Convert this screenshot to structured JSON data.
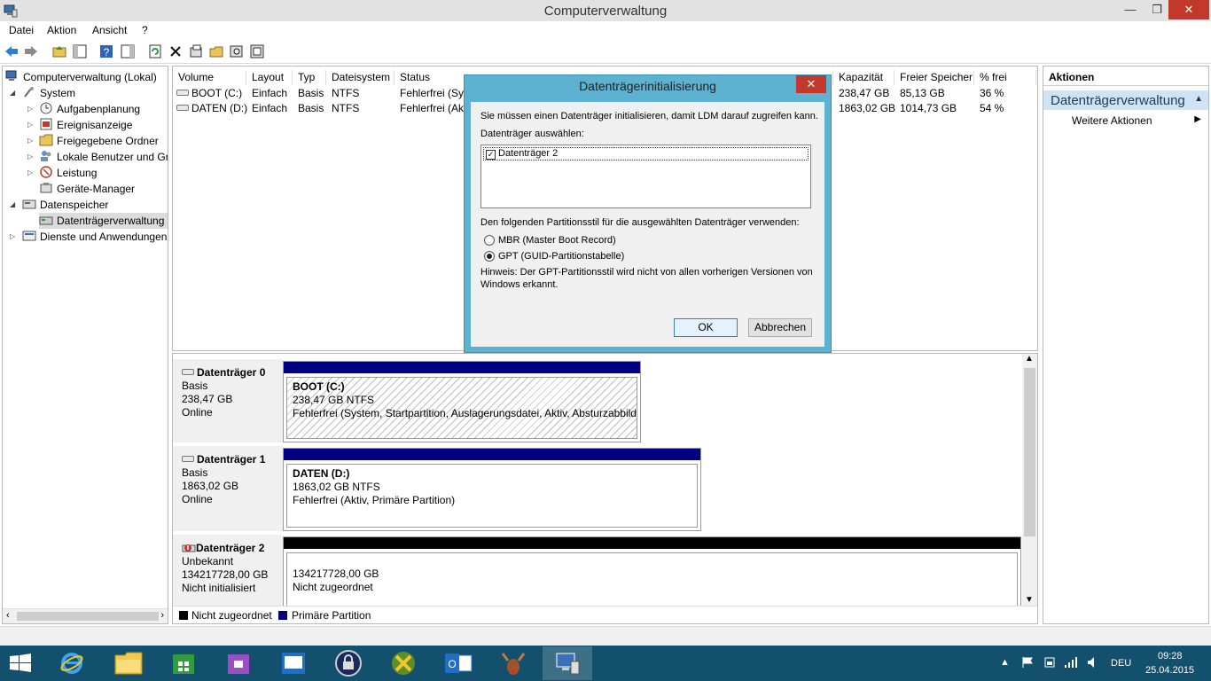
{
  "window": {
    "title": "Computerverwaltung",
    "minimize": "—",
    "maximize": "❐",
    "close": "✕"
  },
  "menu": {
    "items": [
      "Datei",
      "Aktion",
      "Ansicht",
      "?"
    ]
  },
  "tree": {
    "items": [
      {
        "label": "Computerverwaltung (Lokal)"
      },
      {
        "label": "System"
      },
      {
        "label": "Aufgabenplanung"
      },
      {
        "label": "Ereignisanzeige"
      },
      {
        "label": "Freigegebene Ordner"
      },
      {
        "label": "Lokale Benutzer und Gruppen"
      },
      {
        "label": "Leistung"
      },
      {
        "label": "Geräte-Manager"
      },
      {
        "label": "Datenspeicher"
      },
      {
        "label": "Datenträgerverwaltung"
      },
      {
        "label": "Dienste und Anwendungen"
      }
    ]
  },
  "volumes": {
    "columns": [
      "Volume",
      "Layout",
      "Typ",
      "Dateisystem",
      "Status",
      "Kapazität",
      "Freier Speicher",
      "% frei"
    ],
    "rows": [
      {
        "volume": "BOOT (C:)",
        "layout": "Einfach",
        "typ": "Basis",
        "fs": "NTFS",
        "status": "Fehlerfrei (Sys",
        "capacity": "238,47 GB",
        "free": "85,13 GB",
        "pct": "36 %"
      },
      {
        "volume": "DATEN (D:)",
        "layout": "Einfach",
        "typ": "Basis",
        "fs": "NTFS",
        "status": "Fehlerfrei (Akt",
        "capacity": "1863,02 GB",
        "free": "1014,73 GB",
        "pct": "54 %"
      }
    ]
  },
  "disks": [
    {
      "name": "Datenträger 0",
      "type": "Basis",
      "size": "238,47 GB",
      "state": "Online",
      "partition": {
        "title": "BOOT  (C:)",
        "size": "238,47 GB NTFS",
        "status": "Fehlerfrei (System, Startpartition, Auslagerungsdatei, Aktiv, Absturzabbild, Primäre Partition)"
      }
    },
    {
      "name": "Datenträger 1",
      "type": "Basis",
      "size": "1863,02 GB",
      "state": "Online",
      "partition": {
        "title": "DATEN  (D:)",
        "size": "1863,02 GB NTFS",
        "status": "Fehlerfrei (Aktiv, Primäre Partition)"
      }
    },
    {
      "name": "Datenträger 2",
      "type": "Unbekannt",
      "size": "134217728,00 GB",
      "state": "Nicht initialisiert",
      "partition": {
        "title": "",
        "size": "134217728,00 GB",
        "status": "Nicht zugeordnet"
      }
    }
  ],
  "legend": {
    "unallocated": "Nicht zugeordnet",
    "primary": "Primäre Partition",
    "colors": {
      "unallocated": "#000000",
      "primary": "#000080"
    }
  },
  "actions": {
    "header": "Aktionen",
    "section": "Datenträgerverwaltung",
    "more": "Weitere Aktionen"
  },
  "dialog": {
    "title": "Datenträgerinitialisierung",
    "intro": "Sie müssen einen Datenträger initialisieren, damit LDM darauf zugreifen kann.",
    "select_label": "Datenträger auswählen:",
    "disk_item": "Datenträger 2",
    "style_label": "Den folgenden Partitionsstil für die ausgewählten Datenträger verwenden:",
    "mbr": "MBR (Master Boot Record)",
    "gpt": "GPT (GUID-Partitionstabelle)",
    "note1": "Hinweis: Der GPT-Partitionsstil wird nicht von allen vorherigen Versionen von",
    "note2": "Windows erkannt.",
    "ok": "OK",
    "cancel": "Abbrechen"
  },
  "taskbar": {
    "lang": "DEU",
    "time": "09:28",
    "date": "25.04.2015"
  }
}
